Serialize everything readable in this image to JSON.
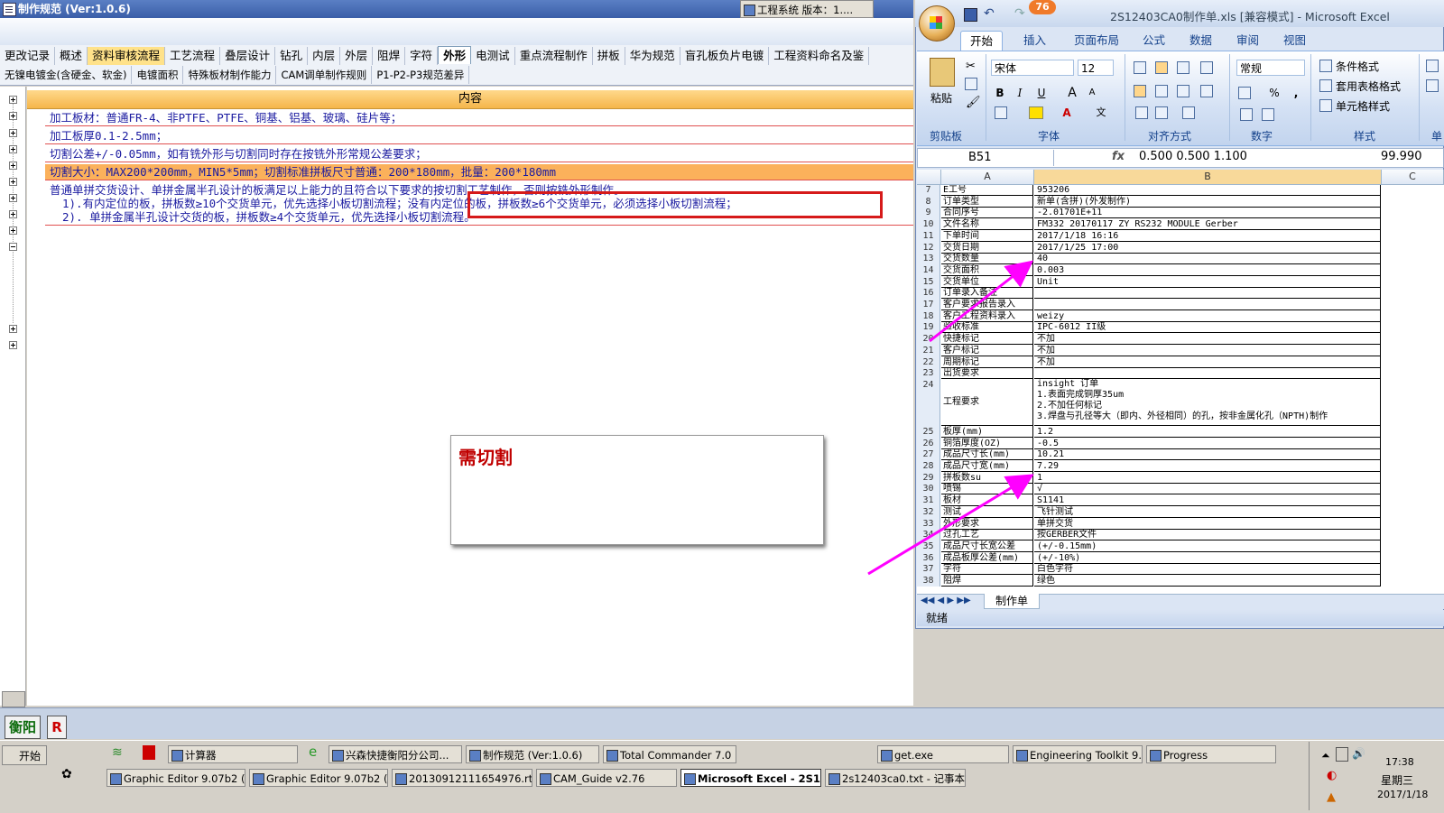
{
  "app": {
    "title": "制作规范 (Ver:1.0.6)",
    "tabs_row1": [
      "更改记录",
      "概述",
      "资料审核流程",
      "工艺流程",
      "叠层设计",
      "钻孔",
      "内层",
      "外层",
      "阻焊",
      "字符",
      "外形",
      "电测试",
      "重点流程制作",
      "拼板",
      "华为规范",
      "盲孔板负片电镀",
      "工程资料命名及鉴"
    ],
    "tabs_row2": [
      "无镍电镀金(含硬金、软金)",
      "电镀面积",
      "特殊板材制作能力",
      "CAM调单制作规则",
      "P1-P2-P3规范差异"
    ],
    "content_header": "内容",
    "rows": {
      "r1": "加工板材：普通FR-4、非PTFE、PTFE、铜基、铝基、玻璃、硅片等；",
      "r2": "加工板厚0.1-2.5mm；",
      "r3": "切割公差+/-0.05mm，如有铣外形与切割同时存在按铣外形常规公差要求；",
      "r4": "切割大小：MAX200*200mm，MIN5*5mm；切割标准拼板尺寸普通：200*180mm，批量：200*180mm",
      "r5_main": "普通单拼交货设计、单拼金属半孔设计的板满足以上能力的且符合以下要求的按切割工艺制作，否则按铣外形制作。",
      "r5_sub1": "1).有内定位的板，拼板数≥10个交货单元，优先选择小板切割流程；没有内定位的板，拼板数≥6个交货单元，必须选择小板切割流程；",
      "r5_sub2": "2). 单拼金属半孔设计交货的板，拼板数≥4个交货单元，优先选择小板切割流程。"
    },
    "popup_text": "需切割",
    "bottom_btn1": "衡阳",
    "bottom_btn2": "R"
  },
  "excel": {
    "title": "2S12403CA0制作单.xls [兼容模式] - Microsoft Excel",
    "badge": "76",
    "tabs": [
      "开始",
      "插入",
      "页面布局",
      "公式",
      "数据",
      "审阅",
      "视图"
    ],
    "ribbon": {
      "paste": "粘贴",
      "font_name": "宋体",
      "font_size": "12",
      "number_format": "常规",
      "cond_format": "条件格式",
      "table_format": "套用表格格式",
      "cell_style": "单元格样式",
      "groups": [
        "剪贴板",
        "字体",
        "对齐方式",
        "数字",
        "样式",
        "单"
      ]
    },
    "name_box": "B51",
    "fx": "fx",
    "formula": "0.500  0.500   1.100",
    "formula_end": "99.990",
    "col_headers": [
      "A",
      "B",
      "C"
    ],
    "rows": [
      {
        "n": "7",
        "a": "E工号",
        "b": "953206"
      },
      {
        "n": "8",
        "a": "订单类型",
        "b": "新单(含拼)(外发制作)"
      },
      {
        "n": "9",
        "a": "合同序号",
        "b": "-2.01701E+11"
      },
      {
        "n": "10",
        "a": "文件名称",
        "b": "FM332 20170117 ZY RS232 MODULE Gerber"
      },
      {
        "n": "11",
        "a": "下单时间",
        "b": "2017/1/18 16:16"
      },
      {
        "n": "12",
        "a": "交货日期",
        "b": "2017/1/25 17:00"
      },
      {
        "n": "13",
        "a": "交货数量",
        "b": "40"
      },
      {
        "n": "14",
        "a": "交货面积",
        "b": "0.003"
      },
      {
        "n": "15",
        "a": "交货单位",
        "b": "Unit"
      },
      {
        "n": "16",
        "a": "订单录入备注",
        "b": ""
      },
      {
        "n": "17",
        "a": "客户要求报告录入",
        "b": ""
      },
      {
        "n": "18",
        "a": "客户工程资料录入",
        "b": "weizy"
      },
      {
        "n": "19",
        "a": "验收标准",
        "b": "IPC-6012 II级"
      },
      {
        "n": "20",
        "a": "快捷标记",
        "b": "不加"
      },
      {
        "n": "21",
        "a": "客户标记",
        "b": "不加"
      },
      {
        "n": "22",
        "a": "周期标记",
        "b": "不加"
      },
      {
        "n": "23",
        "a": "出货要求",
        "b": ""
      }
    ],
    "row24": {
      "n": "24",
      "a": "工程要求",
      "b1": "insight 订单",
      "b2": "1.表面完成铜厚35um",
      "b3": "2.不加任何标记",
      "b4": "3.焊盘与孔径等大（即内、外径相同）的孔，按非金属化孔（NPTH)制作"
    },
    "rows2": [
      {
        "n": "25",
        "a": "板厚(mm)",
        "b": "1.2"
      },
      {
        "n": "26",
        "a": "铜箔厚度(OZ)",
        "b": "-0.5"
      },
      {
        "n": "27",
        "a": "成品尺寸长(mm)",
        "b": "10.21"
      },
      {
        "n": "28",
        "a": "成品尺寸宽(mm)",
        "b": "7.29"
      },
      {
        "n": "29",
        "a": "拼板数su",
        "b": "1"
      },
      {
        "n": "30",
        "a": "喷锡",
        "b": "√"
      },
      {
        "n": "31",
        "a": "板材",
        "b": "S1141"
      },
      {
        "n": "32",
        "a": "测试",
        "b": "飞针测试"
      },
      {
        "n": "33",
        "a": "外形要求",
        "b": "单拼交货"
      },
      {
        "n": "34",
        "a": "过孔工艺",
        "b": "按GERBER文件"
      },
      {
        "n": "35",
        "a": "成品尺寸长宽公差",
        "b": "(+/-0.15mm)"
      },
      {
        "n": "36",
        "a": "成品板厚公差(mm)",
        "b": "(+/-10%)"
      },
      {
        "n": "37",
        "a": "字符",
        "b": "白色字符"
      },
      {
        "n": "38",
        "a": "阻焊",
        "b": "绿色"
      }
    ],
    "sheet_tab": "制作单",
    "status": "就绪"
  },
  "taskbar": {
    "start": "开始",
    "row1": [
      "计算器",
      "兴森快捷衡阳分公司...",
      "制作规范 (Ver:1.0.6)",
      "Total Commander 7.0 ...",
      "工程系统  版本：1....",
      "get.exe",
      "Engineering Toolkit 9....",
      "Progress"
    ],
    "row2": [
      "Graphic Editor 9.07b2 (0...",
      "Graphic Editor 9.07b2 (0...",
      "20130912111654976.rtf...",
      "CAM_Guide v2.76",
      "Microsoft Excel - 2S1...",
      "2s12403ca0.txt - 记事本"
    ],
    "time": "17:38",
    "day": "星期三",
    "date": "2017/1/18"
  },
  "colors": {
    "highlight_row": "#fbb15b",
    "red_box": "#d61a1a",
    "arrow": "#ff00ff",
    "text_blue": "#1a1aa0"
  }
}
